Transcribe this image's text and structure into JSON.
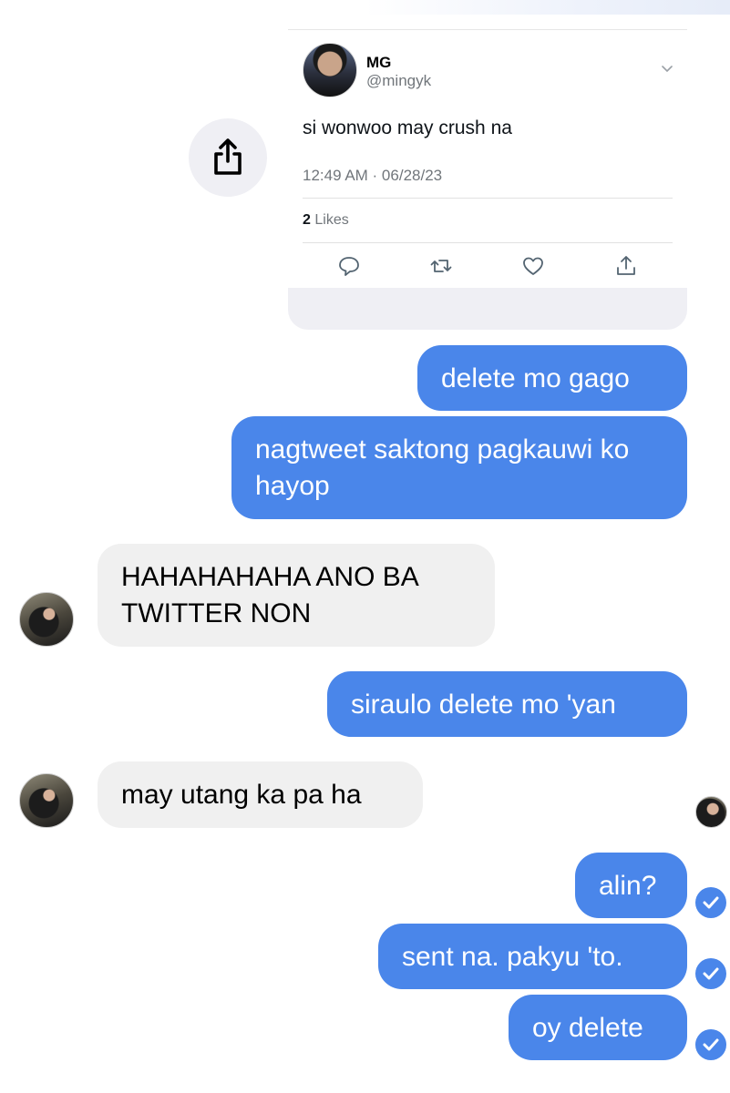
{
  "tweet": {
    "name": "MG",
    "handle": "@mingyk",
    "text": "si wonwoo may crush na",
    "timestamp": "12:49 AM · 06/28/23",
    "likes_count": "2",
    "likes_label": "Likes",
    "icons": [
      "reply-icon",
      "retweet-icon",
      "like-icon",
      "share-icon",
      "chevron-down-icon"
    ]
  },
  "share_button_icon": "share-icon",
  "messages": [
    {
      "direction": "out",
      "text": "delete mo gago"
    },
    {
      "direction": "out",
      "text": "nagtweet saktong pagkauwi ko hayop"
    },
    {
      "direction": "in",
      "text": "HAHAHAHAHA ANO BA TWITTER NON"
    },
    {
      "direction": "out",
      "text": "siraulo delete mo 'yan"
    },
    {
      "direction": "in",
      "text": "may utang ka pa ha"
    },
    {
      "direction": "out",
      "text": "alin?",
      "status": "delivered"
    },
    {
      "direction": "out",
      "text": "sent na. pakyu 'to.",
      "status": "delivered"
    },
    {
      "direction": "out",
      "text": "oy delete",
      "status": "delivered"
    }
  ],
  "colors": {
    "outgoing_bubble": "#4a86ea",
    "incoming_bubble": "#f0f0f0",
    "secondary_text": "#71767b"
  }
}
